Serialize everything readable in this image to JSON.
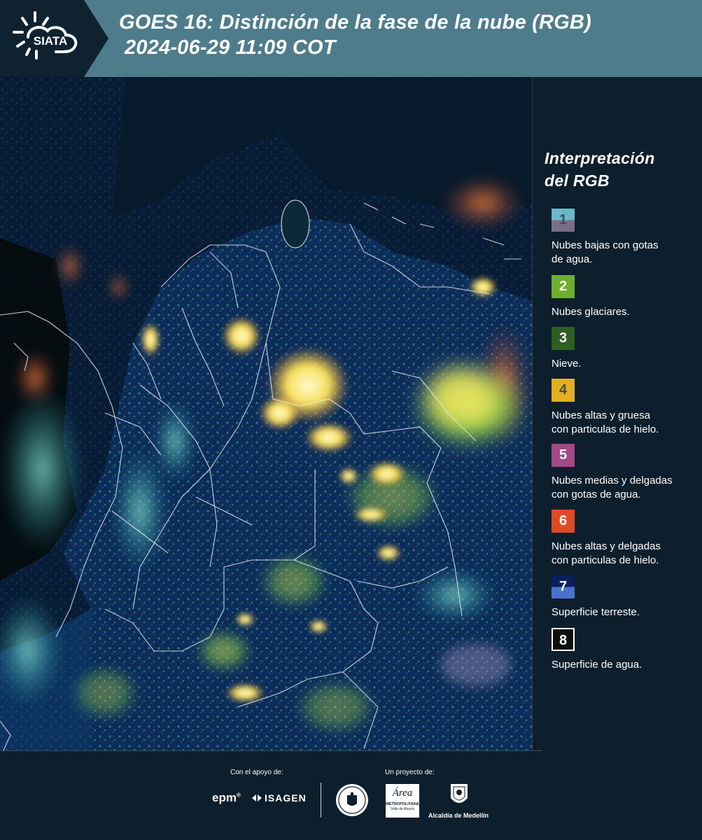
{
  "header": {
    "logo_text": "SIATA",
    "title_line1": "GOES 16: Distinción de la fase de la nube (RGB)",
    "title_line2": "2024-06-29 11:09 COT"
  },
  "legend": {
    "title_line1": "Interpretación",
    "title_line2": "del RGB",
    "items": [
      {
        "num": "1",
        "label_line1": "Nubes bajas con gotas",
        "label_line2": "de agua.",
        "top": "#6bb8c8",
        "bottom": "#7b6f88",
        "num_color": "#4a4a5a"
      },
      {
        "num": "2",
        "label_line1": "Nubes glaciares.",
        "label_line2": "",
        "top": "#6fae2e",
        "bottom": "#6fae2e",
        "num_color": "#ffffff"
      },
      {
        "num": "3",
        "label_line1": "Nieve.",
        "label_line2": "",
        "top": "#2f5e22",
        "bottom": "#2f5e22",
        "num_color": "#ffffff"
      },
      {
        "num": "4",
        "label_line1": "Nubes altas y gruesa",
        "label_line2": "con particulas de hielo.",
        "top": "#e0b020",
        "bottom": "#e0b020",
        "num_color": "#4a4a4a"
      },
      {
        "num": "5",
        "label_line1": "Nubes medias y delgadas",
        "label_line2": "con gotas de agua.",
        "top": "#a14a86",
        "bottom": "#a14a86",
        "num_color": "#ffffff"
      },
      {
        "num": "6",
        "label_line1": "Nubes altas y delgadas",
        "label_line2": "con particulas de hielo.",
        "top": "#e04a26",
        "bottom": "#e04a26",
        "num_color": "#ffffff"
      },
      {
        "num": "7",
        "label_line1": "Superficie terreste.",
        "label_line2": "",
        "top": "#0c1f5e",
        "bottom": "#4a72cc",
        "num_color": "#ffffff"
      },
      {
        "num": "8",
        "label_line1": "Superficie de agua.",
        "label_line2": "",
        "top": "#0a0f08",
        "bottom": "#0a0f08",
        "num_color": "#ffffff"
      }
    ]
  },
  "footer": {
    "support_label": "Con el apoyo de:",
    "project_label": "Un proyecto de:",
    "sponsor1": "epm",
    "sponsor2": "ISAGEN",
    "partner_area_line1": "Área",
    "partner_area_line2": "METROPOLITANA",
    "partner_area_line3": "Valle de Aburrá",
    "partner_alcaldia": "Alcaldía de Medellín"
  }
}
